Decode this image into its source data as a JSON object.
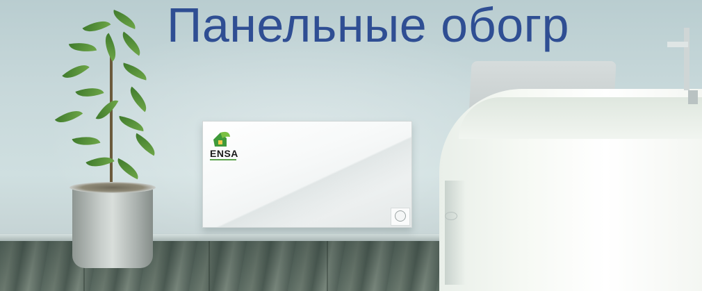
{
  "headline": "Панельные обогр",
  "heater": {
    "brand": "ENSA",
    "logo_icon": "house-leaf-logo-icon"
  },
  "colors": {
    "headline": "#2f4e93",
    "brand_green": "#5aa14b",
    "heater_panel": "#ffffff"
  }
}
